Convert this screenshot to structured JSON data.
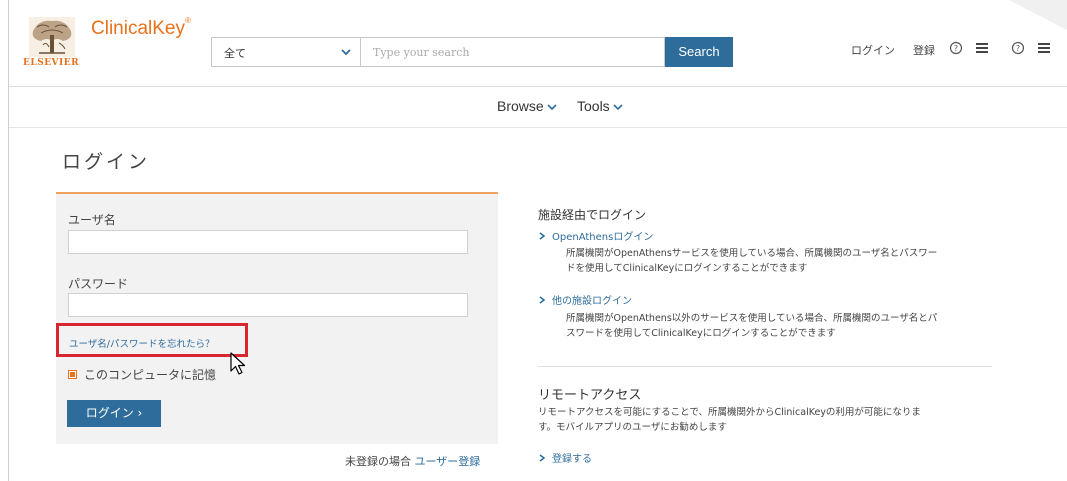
{
  "header": {
    "logo_text": "ELSEVIER",
    "brand": "ClinicalKey",
    "brand_mark": "®",
    "search": {
      "scope_value": "全て",
      "placeholder": "Type your search",
      "button_label": "Search"
    },
    "links": {
      "login": "ログイン",
      "register": "登録"
    },
    "icons": [
      "help-icon",
      "menu-icon",
      "help-icon",
      "menu-icon"
    ]
  },
  "nav": {
    "browse": "Browse",
    "tools": "Tools"
  },
  "page_title": "ログイン",
  "login_form": {
    "username_label": "ユーザ名",
    "username_value": "",
    "password_label": "パスワード",
    "password_value": "",
    "forgot_link": "ユーザ名/パスワードを忘れたら？",
    "remember_label": "このコンピュータに記憶",
    "remember_checked": true,
    "submit_label": "ログイン ›"
  },
  "register": {
    "text": "未登録の場合",
    "link": "ユーザー登録"
  },
  "institution": {
    "title": "施設経由でログイン",
    "openathens_link": "OpenAthensログイン",
    "openathens_desc_1": "所属機関がOpenAthensサービスを使用している場合、所属機関のユーザ名とパスワー",
    "openathens_desc_2": "ドを使用してClinicalKeyにログインすることができます",
    "other_link": "他の施設ログイン",
    "other_desc_1": "所属機関がOpenAthens以外のサービスを使用している場合、所属機関のユーザ名とパ",
    "other_desc_2": "スワードを使用してClinicalKeyにログインすることができます"
  },
  "remote": {
    "title": "リモートアクセス",
    "desc_1": "リモートアクセスを可能にすることで、所属機関外からClinicalKeyの利用が可能になりま",
    "desc_2": "す。モバイルアプリのユーザにお勧めします",
    "register_link": "登録する"
  },
  "colors": {
    "brand_orange": "#e9711c",
    "primary_blue": "#2e6c9c",
    "highlight_red": "#d8262e"
  }
}
